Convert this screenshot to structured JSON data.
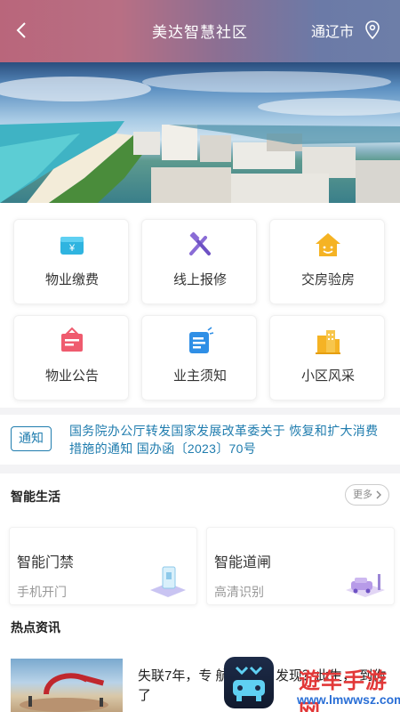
{
  "header": {
    "title": "美达智慧社区",
    "city": "通辽市"
  },
  "grid": {
    "items": [
      {
        "label": "物业缴费",
        "icon": "yen-wallet-icon"
      },
      {
        "label": "线上报修",
        "icon": "wrench-hammer-icon"
      },
      {
        "label": "交房验房",
        "icon": "smiling-house-icon"
      },
      {
        "label": "物业公告",
        "icon": "announcement-board-icon"
      },
      {
        "label": "业主须知",
        "icon": "notice-document-icon"
      },
      {
        "label": "小区风采",
        "icon": "buildings-icon"
      }
    ]
  },
  "notice": {
    "tag": "通知",
    "text": "国务院办公厅转发国家发展改革委关于 恢复和扩大消费措施的通知  国办函〔2023〕70号"
  },
  "smart_life": {
    "title": "智能生活",
    "more": "更多",
    "cards": [
      {
        "title": "智能门禁",
        "subtitle": "手机开门"
      },
      {
        "title": "智能道闸",
        "subtitle": "高清识别"
      }
    ]
  },
  "hot_news": {
    "title": "热点资讯",
    "headline": "失联7年，专              航MH370              发现？此生，                 到你了"
  },
  "watermark": {
    "line1": "遊车手游网",
    "line2": "www.lmwwsz.com"
  },
  "colors": {
    "accent": "#1f7cae",
    "header_start": "#b9667b",
    "header_end": "#6d7ea8"
  }
}
